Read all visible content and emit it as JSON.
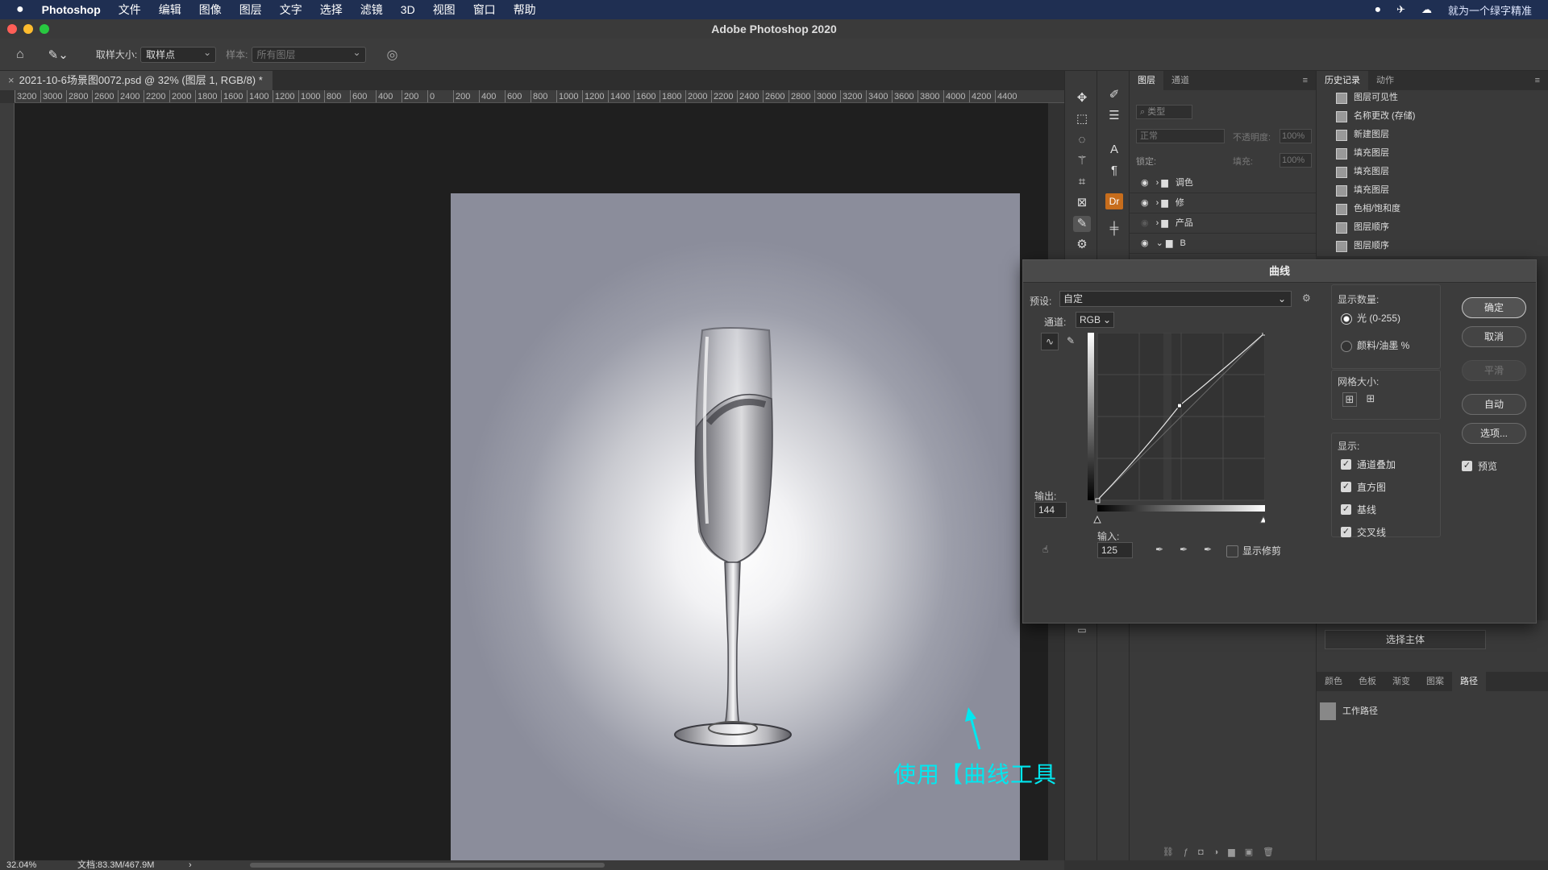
{
  "menubar": {
    "apple": "",
    "app_name": "Photoshop",
    "items": [
      "文件",
      "编辑",
      "图像",
      "图层",
      "文字",
      "选择",
      "滤镜",
      "3D",
      "视图",
      "窗口",
      "帮助"
    ],
    "right_status": "就为一个绿字精准"
  },
  "window": {
    "title": "Adobe Photoshop 2020"
  },
  "options": {
    "sample_size_label": "取样大小:",
    "sample_size_value": "取样点",
    "sample_label": "样本:",
    "sample_value": "所有图层"
  },
  "document": {
    "tab_title": "2021-10-6场景图0072.psd @ 32% (图层 1, RGB/8) *",
    "ruler_ticks": [
      "3200",
      "3000",
      "2800",
      "2600",
      "2400",
      "2200",
      "2000",
      "1800",
      "1600",
      "1400",
      "1200",
      "1000",
      "800",
      "600",
      "400",
      "200",
      "0",
      "200",
      "400",
      "600",
      "800",
      "1000",
      "1200",
      "1400",
      "1600",
      "1800",
      "2000",
      "2200",
      "2400",
      "2600",
      "2800",
      "3000",
      "3200",
      "3400",
      "3600",
      "3800",
      "4000",
      "4200",
      "4400"
    ],
    "zoom": "32.04%",
    "doc_size": "文档:83.3M/467.9M"
  },
  "layers": {
    "tabs": [
      "图层",
      "通道"
    ],
    "kind_placeholder": "类型",
    "blend_mode": "正常",
    "opacity_label": "不透明度:",
    "opacity_value": "100%",
    "lock_label": "锁定:",
    "fill_label": "填充:",
    "fill_value": "100%",
    "rows": [
      {
        "name": "调色"
      },
      {
        "name": "修"
      },
      {
        "name": "产品"
      },
      {
        "name": "B"
      }
    ]
  },
  "history": {
    "tabs": [
      "历史记录",
      "动作"
    ],
    "items": [
      "图层可见性",
      "名称更改 (存储)",
      "新建图层",
      "填充图层",
      "填充图层",
      "填充图层",
      "色相/饱和度",
      "图层顺序",
      "图层顺序"
    ]
  },
  "lower_panel": {
    "select_subject": "选择主体",
    "tabs": [
      "颜色",
      "色板",
      "渐变",
      "图案",
      "路径"
    ],
    "path_item": "工作路径"
  },
  "curves": {
    "title": "曲线",
    "preset_label": "预设:",
    "preset_value": "自定",
    "channel_label": "通道:",
    "channel_value": "RGB",
    "output_label": "输出:",
    "output_value": "144",
    "input_label": "输入:",
    "input_value": "125",
    "show_clipping": "显示修剪",
    "display_amount_label": "显示数量:",
    "radio_light": "光 (0-255)",
    "radio_pigment": "颜料/油墨 %",
    "grid_size_label": "网格大小:",
    "display_label": "显示:",
    "checks": [
      "通道叠加",
      "直方图",
      "基线",
      "交叉线"
    ],
    "preview": "预览",
    "buttons": {
      "ok": "确定",
      "cancel": "取消",
      "smooth": "平滑",
      "auto": "自动",
      "options": "选项..."
    },
    "point": {
      "input": 125,
      "output": 144
    }
  },
  "subtitle": "使用【曲线工具 快捷键：Ctrl+M】上拉曲线略微提亮背景",
  "colors": {
    "accent": "#00e8f0",
    "menubar": "#1f2f52"
  }
}
